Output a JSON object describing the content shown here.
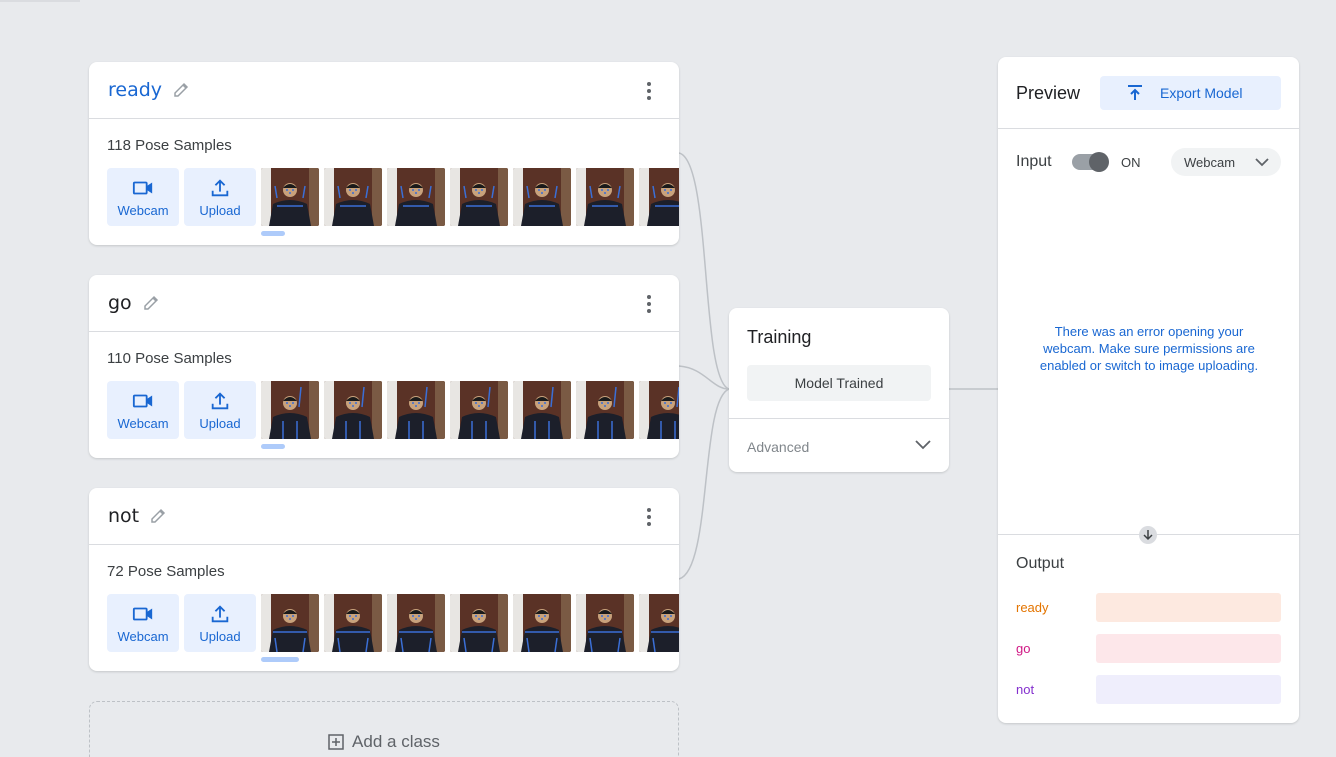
{
  "classes": [
    {
      "name": "ready",
      "count_label": "118 Pose Samples",
      "webcam_label": "Webcam",
      "upload_label": "Upload",
      "active": true
    },
    {
      "name": "go",
      "count_label": "110 Pose Samples",
      "webcam_label": "Webcam",
      "upload_label": "Upload",
      "active": false
    },
    {
      "name": "not",
      "count_label": "72 Pose Samples",
      "webcam_label": "Webcam",
      "upload_label": "Upload",
      "active": false
    }
  ],
  "add_class_label": "Add a class",
  "training": {
    "title": "Training",
    "button_label": "Model Trained",
    "advanced_label": "Advanced"
  },
  "preview": {
    "title": "Preview",
    "export_label": "Export Model",
    "input_label": "Input",
    "toggle_state": "ON",
    "source_select": "Webcam",
    "error_message": "There was an error opening your webcam. Make sure permissions are enabled or switch to image uploading.",
    "output_title": "Output",
    "outputs": [
      {
        "label": "ready",
        "color": "#e37400",
        "bar_color": "#fde9e0"
      },
      {
        "label": "go",
        "color": "#d01884",
        "bar_color": "#fde7ea"
      },
      {
        "label": "not",
        "color": "#8430ce",
        "bar_color": "#efeefc"
      }
    ]
  },
  "colors": {
    "accent": "#1967d2",
    "accent_light": "#e8f0fe"
  }
}
